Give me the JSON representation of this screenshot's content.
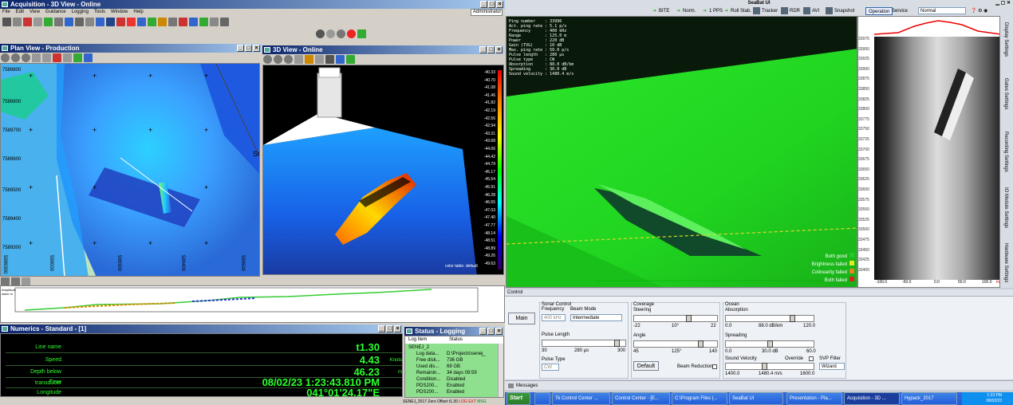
{
  "left_app": {
    "title": "Acquisition - 3D View - Online",
    "menu": [
      "File",
      "Edit",
      "View",
      "Guidance",
      "Logging",
      "Tools",
      "Window",
      "Help"
    ],
    "user": "Administrator"
  },
  "plan_view": {
    "title": "Plan View - Production",
    "y_labels": [
      "7589800",
      "7589800",
      "7589700",
      "7589600",
      "7589500",
      "7589400",
      "7589300"
    ],
    "x_labels": [
      "5989300",
      "599000",
      "599300",
      "599400",
      "599500"
    ],
    "edge_label": "SC"
  },
  "view3d": {
    "title": "3D View - Online",
    "scale": [
      "-40.33",
      "-40.70",
      "-41.08",
      "-41.46",
      "-41.82",
      "-42.19",
      "-42.56",
      "-42.94",
      "-43.31",
      "-43.68",
      "-44.06",
      "-44.42",
      "-44.79",
      "-45.17",
      "-45.54",
      "-45.91",
      "-46.28",
      "-46.65",
      "-47.03",
      "-47.40",
      "-47.77",
      "-48.14",
      "-48.51",
      "-48.89",
      "-49.26",
      "-49.63"
    ],
    "footer": "color table: default"
  },
  "profile": {
    "label": "Amplitude wave m"
  },
  "numerics": {
    "title": "Numerics - Standard - [1]",
    "rows": [
      {
        "label": "Line name",
        "value": "t1.30",
        "unit": ""
      },
      {
        "label": "Speed",
        "value": "4.43",
        "unit": "Knots"
      },
      {
        "label": "Depth below transducer",
        "value": "46.23",
        "unit": "m"
      },
      {
        "label": "Time",
        "value": "08/02/23 1:23:43.810 PM",
        "unit": ""
      },
      {
        "label": "Longitude",
        "value": "041°01'24.17\"E",
        "unit": ""
      }
    ]
  },
  "status": {
    "title": "Status - Logging",
    "headers": [
      "Log Item",
      "Status"
    ],
    "rows": [
      {
        "item": "SENEJ_2",
        "status": ""
      },
      {
        "item": "Log data...",
        "status": "D:\\Projects\\senej_"
      },
      {
        "item": "Free disk...",
        "status": "736 GB"
      },
      {
        "item": "Used dis...",
        "status": "69 GB"
      },
      {
        "item": "Remainin...",
        "status": "34 days 09:59"
      },
      {
        "item": "Condition...",
        "status": "Disabled"
      },
      {
        "item": "PDS200...",
        "status": "Enabled"
      },
      {
        "item": "PDS200...",
        "status": "Enabled"
      }
    ]
  },
  "statusbar": [
    "SENEJ_2017",
    "Zero Offset",
    "t1.30",
    "LOG",
    "EXT",
    "MSG"
  ],
  "right_app": {
    "title": "SeaBat UI",
    "indicators": [
      "BITE",
      "Norm.",
      "1 PPS",
      "Roll Stab."
    ],
    "buttons": [
      "Tracker",
      "RDR",
      "AVI",
      "Snapshot"
    ],
    "tabs": [
      "Operation",
      "Service"
    ],
    "mode": "Normal"
  },
  "sonar_info": [
    "Ping number    : 33996",
    "Act. ping rate : 5.1 p/s",
    "Frequency      : 400 kHz",
    "Range          : 125.0 m",
    "Power          : 220 dB",
    "Gain (TVG)     : 10 dB",
    "Max. ping rate : 50.0 p/s",
    "Pulse length   : 280 µs",
    "Pulse type     : CW",
    "Absorption     : 88.0 dB/km",
    "Spreading      : 30.0 dB",
    "Sound velocity : 1480.4 m/s"
  ],
  "legend": [
    {
      "label": "Both good",
      "color": "#22cc22"
    },
    {
      "label": "Brightness failed",
      "color": "#e8e820"
    },
    {
      "label": "Colinearity failed",
      "color": "#f08020"
    },
    {
      "label": "Both failed",
      "color": "#e02020"
    }
  ],
  "waterfall_scale": [
    "33975",
    "33950",
    "33925",
    "33900",
    "33875",
    "33850",
    "33825",
    "33800",
    "33775",
    "33750",
    "33725",
    "33700",
    "33675",
    "33650",
    "33625",
    "33600",
    "33575",
    "33550",
    "33525",
    "33500",
    "33475",
    "33450",
    "33425",
    "33400"
  ],
  "waterfall_x": [
    "-100.0",
    "-50.0",
    "0.0",
    "50.0",
    "100.0"
  ],
  "waterfall_unit": "m",
  "side_tabs": [
    "Display Settings",
    "Gates Settings",
    "Recording Settings",
    "IO Module Settings",
    "Hardware Settings"
  ],
  "control": {
    "title": "Control",
    "main": "Main",
    "sonar_control": "Sonar Control",
    "frequency_label": "Frequency",
    "frequency_value": "400 kHz",
    "beam_mode_label": "Beam Mode",
    "beam_mode_value": "Intermediate",
    "pulse_length_label": "Pulse Length",
    "pulse_min": "30",
    "pulse_val": "280 µs",
    "pulse_max": "300",
    "pulse_type_label": "Pulse Type",
    "pulse_type_value": "CW",
    "coverage": "Coverage",
    "steering_label": "Steering",
    "steer_min": "-22",
    "steer_val": "10°",
    "steer_max": "22",
    "angle_label": "Angle",
    "angle_min": "45",
    "angle_val": "125°",
    "angle_max": "140",
    "default_btn": "Default",
    "beam_reduction": "Beam Reduction",
    "ocean": "Ocean",
    "absorption_label": "Absorption",
    "abs_min": "0.0",
    "abs_val": "88.0 dB/km",
    "abs_max": "120.0",
    "spreading_label": "Spreading",
    "spr_min": "0.0",
    "spr_val": "30.0 dB",
    "spr_max": "60.0",
    "sv_label": "Sound Velocity",
    "override": "Override",
    "sv_min": "1400.0",
    "sv_val": "1480.4 m/s",
    "sv_max": "1600.0",
    "svp_label": "SVP Filter",
    "svp_value": "Wizard"
  },
  "messages": "Messages",
  "taskbar": {
    "start": "Start",
    "items": [
      "7k Control Center ...",
      "Control Center - [E...",
      "C:\\Program Files (...",
      "SeaBat UI",
      "Presentation - Pla...",
      "Acquisition - 3D ...",
      "Hypack_2017"
    ],
    "time": "1:23 PM",
    "date": "08/02/23"
  }
}
